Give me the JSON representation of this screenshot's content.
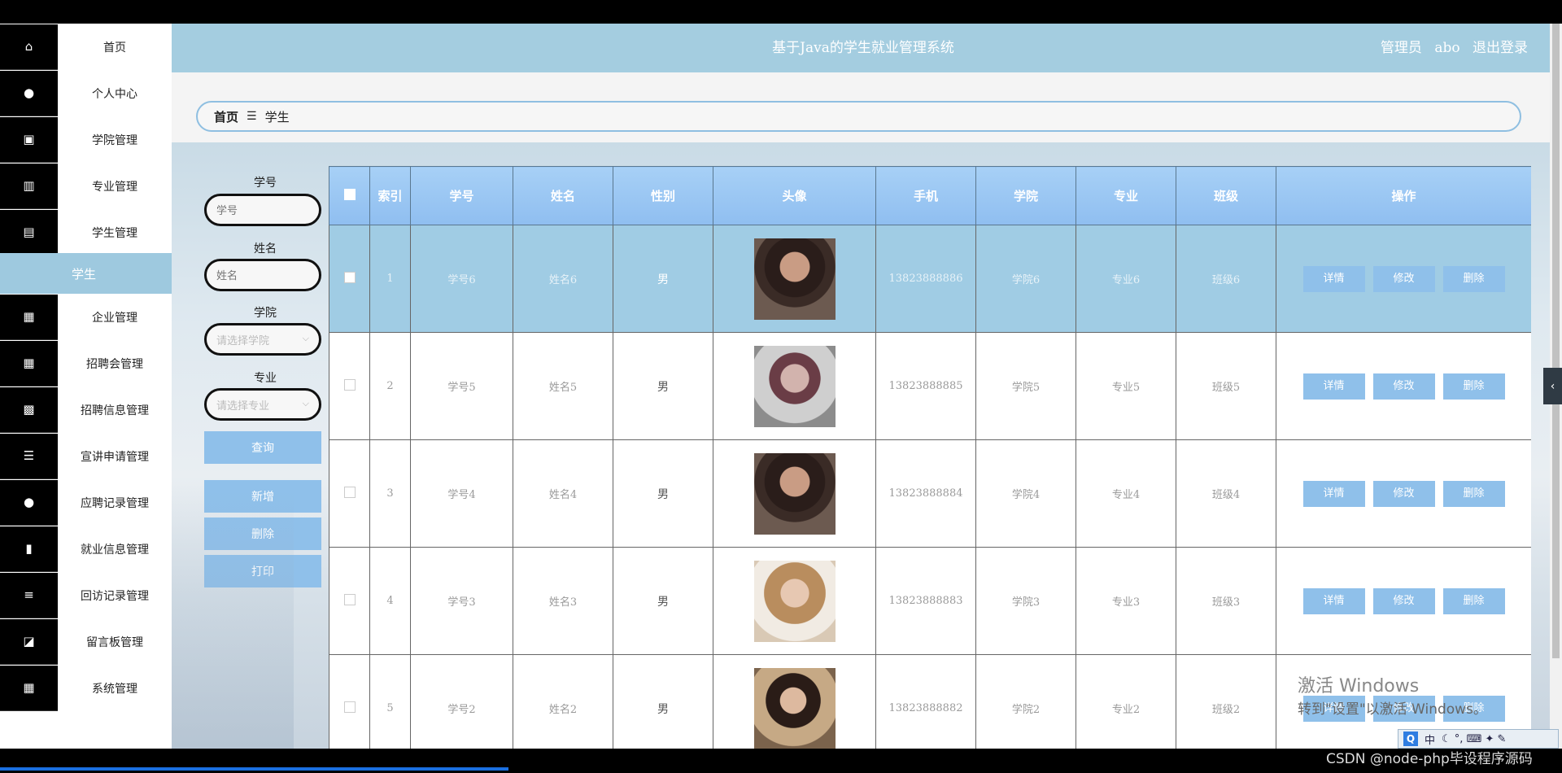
{
  "header": {
    "title": "基于Java的学生就业管理系统",
    "role": "管理员",
    "username": "abo",
    "logout": "退出登录"
  },
  "breadcrumb": {
    "home": "首页",
    "separator": "☰",
    "current": "学生"
  },
  "sidebar": {
    "items": [
      {
        "label": "首页",
        "icon": "home-icon"
      },
      {
        "label": "个人中心",
        "icon": "user-icon"
      },
      {
        "label": "学院管理",
        "icon": "briefcase-icon"
      },
      {
        "label": "专业管理",
        "icon": "bar-chart-icon"
      },
      {
        "label": "学生管理",
        "icon": "building-icon"
      },
      {
        "label": "学生",
        "icon": ""
      },
      {
        "label": "企业管理",
        "icon": "grid-icon"
      },
      {
        "label": "招聘会管理",
        "icon": "grid-icon"
      },
      {
        "label": "招聘信息管理",
        "icon": "table-icon"
      },
      {
        "label": "宣讲申请管理",
        "icon": "sliders-icon"
      },
      {
        "label": "应聘记录管理",
        "icon": "user-icon"
      },
      {
        "label": "就业信息管理",
        "icon": "book-icon"
      },
      {
        "label": "回访记录管理",
        "icon": "list-icon"
      },
      {
        "label": "留言板管理",
        "icon": "chart-icon"
      },
      {
        "label": "系统管理",
        "icon": "grid-icon"
      }
    ]
  },
  "search": {
    "student_no_label": "学号",
    "student_no_placeholder": "学号",
    "name_label": "姓名",
    "name_placeholder": "姓名",
    "college_label": "学院",
    "college_placeholder": "请选择学院",
    "major_label": "专业",
    "major_placeholder": "请选择专业",
    "query": "查询",
    "add": "新增",
    "delete": "删除",
    "print": "打印"
  },
  "table": {
    "headers": [
      "索引",
      "学号",
      "姓名",
      "性别",
      "头像",
      "手机",
      "学院",
      "专业",
      "班级",
      "操作"
    ],
    "rows": [
      {
        "index": "1",
        "student_no": "学号6",
        "name": "姓名6",
        "gender": "男",
        "phone": "13823888886",
        "college": "学院6",
        "major": "专业6",
        "class": "班级6"
      },
      {
        "index": "2",
        "student_no": "学号5",
        "name": "姓名5",
        "gender": "男",
        "phone": "13823888885",
        "college": "学院5",
        "major": "专业5",
        "class": "班级5"
      },
      {
        "index": "3",
        "student_no": "学号4",
        "name": "姓名4",
        "gender": "男",
        "phone": "13823888884",
        "college": "学院4",
        "major": "专业4",
        "class": "班级4"
      },
      {
        "index": "4",
        "student_no": "学号3",
        "name": "姓名3",
        "gender": "男",
        "phone": "13823888883",
        "college": "学院3",
        "major": "专业3",
        "class": "班级3"
      },
      {
        "index": "5",
        "student_no": "学号2",
        "name": "姓名2",
        "gender": "男",
        "phone": "13823888882",
        "college": "学院2",
        "major": "专业2",
        "class": "班级2"
      }
    ],
    "actions": {
      "detail": "详情",
      "edit": "修改",
      "delete": "删除"
    }
  },
  "watermark": {
    "line1": "激活 Windows",
    "line2": "转到\"设置\"以激活 Windows。"
  },
  "ime": {
    "q": "Q",
    "mode": "中",
    "extra": "☾ °, ⌨ ✦ ✎"
  },
  "credit": "CSDN @node-php毕设程序源码",
  "colors": {
    "header": "#a4cde0",
    "button": "#8fc0ea",
    "selected_row": "#a0cce4",
    "sidebar_icon_bg": "#000000"
  }
}
